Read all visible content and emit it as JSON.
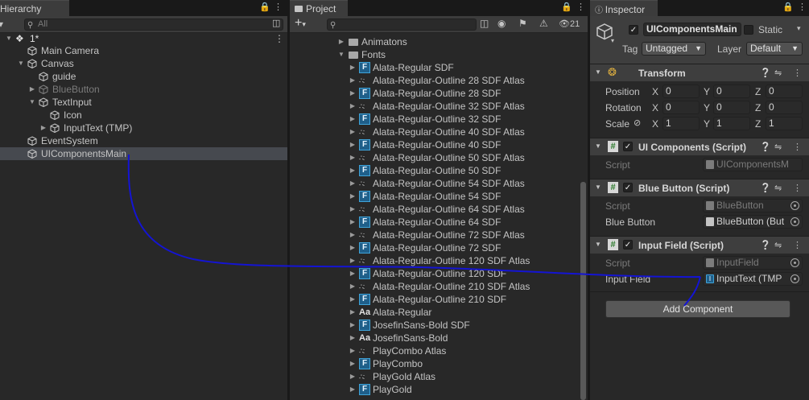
{
  "colors": {
    "panel_bg": "#282828",
    "tab_bg": "#3c3c3c",
    "selection": "#46494f",
    "accent_blue": "#3fa3d8",
    "wire": "#1414d4"
  },
  "hierarchy": {
    "tab_label": "Hierarchy",
    "search_placeholder": "All",
    "scene_name": "1*",
    "items": [
      {
        "label": "Main Camera"
      },
      {
        "label": "Canvas"
      },
      {
        "label": "guide"
      },
      {
        "label": "BlueButton"
      },
      {
        "label": "TextInput"
      },
      {
        "label": "Icon"
      },
      {
        "label": "InputText (TMP)"
      },
      {
        "label": "EventSystem"
      },
      {
        "label": "UIComponentsMain"
      }
    ]
  },
  "project": {
    "tab_label": "Project",
    "add_label": "+",
    "hidden_count": "21",
    "folders": [
      {
        "label": "Animatons"
      },
      {
        "label": "Fonts"
      }
    ],
    "files": [
      {
        "label": "Alata-Regular SDF",
        "icon": "font-asset-icon"
      },
      {
        "label": "Alata-Regular-Outline 28 SDF Atlas",
        "icon": "atlas-icon"
      },
      {
        "label": "Alata-Regular-Outline 28 SDF",
        "icon": "font-asset-icon"
      },
      {
        "label": "Alata-Regular-Outline 32 SDF Atlas",
        "icon": "atlas-icon"
      },
      {
        "label": "Alata-Regular-Outline 32 SDF",
        "icon": "font-asset-icon"
      },
      {
        "label": "Alata-Regular-Outline 40 SDF Atlas",
        "icon": "atlas-icon"
      },
      {
        "label": "Alata-Regular-Outline 40 SDF",
        "icon": "font-asset-icon"
      },
      {
        "label": "Alata-Regular-Outline 50 SDF Atlas",
        "icon": "atlas-icon"
      },
      {
        "label": "Alata-Regular-Outline 50 SDF",
        "icon": "font-asset-icon"
      },
      {
        "label": "Alata-Regular-Outline 54 SDF Atlas",
        "icon": "atlas-icon"
      },
      {
        "label": "Alata-Regular-Outline 54 SDF",
        "icon": "font-asset-icon"
      },
      {
        "label": "Alata-Regular-Outline 64 SDF Atlas",
        "icon": "atlas-icon"
      },
      {
        "label": "Alata-Regular-Outline 64 SDF",
        "icon": "font-asset-icon"
      },
      {
        "label": "Alata-Regular-Outline 72 SDF Atlas",
        "icon": "atlas-icon"
      },
      {
        "label": "Alata-Regular-Outline 72 SDF",
        "icon": "font-asset-icon"
      },
      {
        "label": "Alata-Regular-Outline 120 SDF Atlas",
        "icon": "atlas-icon"
      },
      {
        "label": "Alata-Regular-Outline 120 SDF",
        "icon": "font-asset-icon"
      },
      {
        "label": "Alata-Regular-Outline 210 SDF Atlas",
        "icon": "atlas-icon"
      },
      {
        "label": "Alata-Regular-Outline 210 SDF",
        "icon": "font-asset-icon"
      },
      {
        "label": "Alata-Regular",
        "icon": "font-file-icon"
      },
      {
        "label": "JosefinSans-Bold SDF",
        "icon": "font-asset-icon"
      },
      {
        "label": "JosefinSans-Bold",
        "icon": "font-file-icon"
      },
      {
        "label": "PlayCombo Atlas",
        "icon": "atlas-icon"
      },
      {
        "label": "PlayCombo",
        "icon": "font-asset-icon"
      },
      {
        "label": "PlayGold Atlas",
        "icon": "atlas-icon"
      },
      {
        "label": "PlayGold",
        "icon": "font-asset-icon"
      }
    ]
  },
  "inspector": {
    "tab_label": "Inspector",
    "object_name": "UIComponentsMain",
    "static_label": "Static",
    "tag_label": "Tag",
    "tag_value": "Untagged",
    "layer_label": "Layer",
    "layer_value": "Default",
    "transform": {
      "title": "Transform",
      "position_label": "Position",
      "position": {
        "x": "0",
        "y": "0",
        "z": "0"
      },
      "rotation_label": "Rotation",
      "rotation": {
        "x": "0",
        "y": "0",
        "z": "0"
      },
      "scale_label": "Scale",
      "scale": {
        "x": "1",
        "y": "1",
        "z": "1"
      },
      "x_axis": "X",
      "y_axis": "Y",
      "z_axis": "Z"
    },
    "ui_components": {
      "title": "UI Components (Script)",
      "script_label": "Script",
      "script_value": "UIComponentsM"
    },
    "blue_button": {
      "title": "Blue Button (Script)",
      "script_label": "Script",
      "script_value": "BlueButton",
      "field_label": "Blue Button",
      "field_value": "BlueButton (But"
    },
    "input_field": {
      "title": "Input Field (Script)",
      "script_label": "Script",
      "script_value": "InputField",
      "field_label": "Input Field",
      "field_value": "InputText (TMP"
    },
    "add_component_label": "Add Component"
  }
}
